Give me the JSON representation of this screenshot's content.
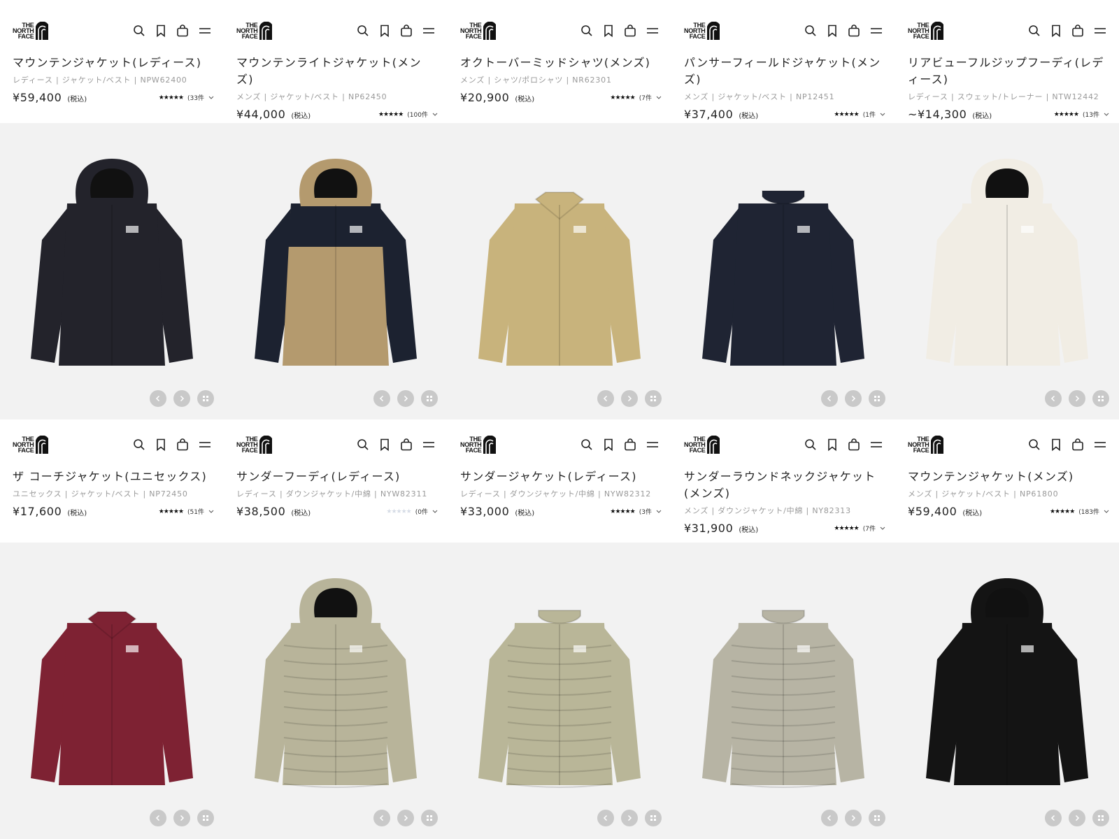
{
  "brand": {
    "logo_lines": [
      "THE",
      "NORTH",
      "FACE"
    ]
  },
  "tax_label": "(税込)",
  "colors": {
    "image_bg": "#f2f2f2",
    "star_filled": "#111111",
    "star_empty": "#d6dce6",
    "control_bg": "#c9c9c9"
  },
  "products": [
    {
      "title": "マウンテンジャケット(レディース)",
      "meta": "レディース | ジャケット/ベスト | NPW62400",
      "price": "¥59,400",
      "stars": "★★★★★",
      "review_count": "(33件",
      "image_icon": "hooded-shell-jacket-black",
      "garment_color": "#23232b",
      "accent_color": "#23232b"
    },
    {
      "title": "マウンテンライトジャケット(メンズ)",
      "meta": "メンズ | ジャケット/ベスト | NP62450",
      "price": "¥44,000",
      "stars": "★★★★★",
      "review_count": "(100件",
      "image_icon": "hooded-shell-jacket-khaki-black",
      "garment_color": "#b49a6e",
      "accent_color": "#1c2230"
    },
    {
      "title": "オクトーバーミッドシャツ(メンズ)",
      "meta": "メンズ | シャツ/ポロシャツ | NR62301",
      "price": "¥20,900",
      "stars": "★★★★★",
      "review_count": "(7件",
      "image_icon": "button-shirt-beige",
      "garment_color": "#c8b37c",
      "accent_color": "#c8b37c"
    },
    {
      "title": "パンサーフィールドジャケット(メンズ)",
      "meta": "メンズ | ジャケット/ベスト | NP12451",
      "price": "¥37,400",
      "stars": "★★★★★",
      "review_count": "(1件",
      "image_icon": "field-jacket-navy",
      "garment_color": "#1f2433",
      "accent_color": "#1f2433"
    },
    {
      "title": "リアビューフルジップフーディ(レディース)",
      "meta": "レディース | スウェット/トレーナー | NTW12442",
      "price": "~¥14,300",
      "stars": "★★★★★",
      "review_count": "(13件",
      "image_icon": "zip-hoodie-cream",
      "garment_color": "#f1ede4",
      "accent_color": "#f1ede4"
    },
    {
      "title": "ザ コーチジャケット(ユニセックス)",
      "meta": "ユニセックス | ジャケット/ベスト | NP72450",
      "price": "¥17,600",
      "stars": "★★★★★",
      "review_count": "(51件",
      "image_icon": "coach-jacket-burgundy",
      "garment_color": "#7e2233",
      "accent_color": "#7e2233"
    },
    {
      "title": "サンダーフーディ(レディース)",
      "meta": "レディース | ダウンジャケット/中綿 | NYW82311",
      "price": "¥38,500",
      "stars": "★★★★★",
      "stars_empty": true,
      "review_count": "(0件",
      "image_icon": "down-hoodie-sage",
      "garment_color": "#b8b49a",
      "accent_color": "#b8b49a"
    },
    {
      "title": "サンダージャケット(レディース)",
      "meta": "レディース | ダウンジャケット/中綿 | NYW82312",
      "price": "¥33,000",
      "stars": "★★★★★",
      "review_count": "(3件",
      "image_icon": "down-jacket-sage",
      "garment_color": "#b9b698",
      "accent_color": "#b9b698"
    },
    {
      "title": "サンダーラウンドネックジャケット(メンズ)",
      "meta": "メンズ | ダウンジャケット/中綿 | NY82313",
      "price": "¥31,900",
      "stars": "★★★★★",
      "review_count": "(7件",
      "image_icon": "round-neck-down-jacket-gray",
      "garment_color": "#b7b4a4",
      "accent_color": "#b7b4a4"
    },
    {
      "title": "マウンテンジャケット(メンズ)",
      "meta": "メンズ | ジャケット/ベスト | NP61800",
      "price": "¥59,400",
      "stars": "★★★★★",
      "review_count": "(183件",
      "image_icon": "hooded-shell-jacket-black",
      "garment_color": "#141414",
      "accent_color": "#141414"
    }
  ]
}
